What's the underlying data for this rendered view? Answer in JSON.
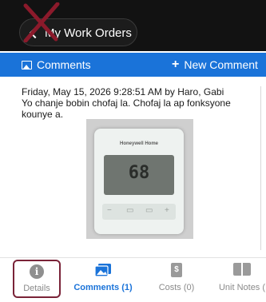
{
  "header": {
    "back_label": "My Work Orders"
  },
  "comment_bar": {
    "title": "Comments",
    "new_comment_label": "New Comment"
  },
  "comment": {
    "meta": "Friday, May 15, 2026 9:28:51 AM by Haro, Gabi",
    "text_line1": "Yo chanje bobin chofaj la. Chofaj la ap fonksyone",
    "text_line2": "kounye a."
  },
  "photo": {
    "brand": "Honeywell Home",
    "temp": "68"
  },
  "tabs": {
    "details": "Details",
    "comments": "Comments (1)",
    "costs": "Costs (0)",
    "unit_notes": "Unit Notes ("
  },
  "colors": {
    "accent": "#1a73d9",
    "highlight_border": "#7a2338",
    "annotation_x": "#8b1a2b"
  }
}
